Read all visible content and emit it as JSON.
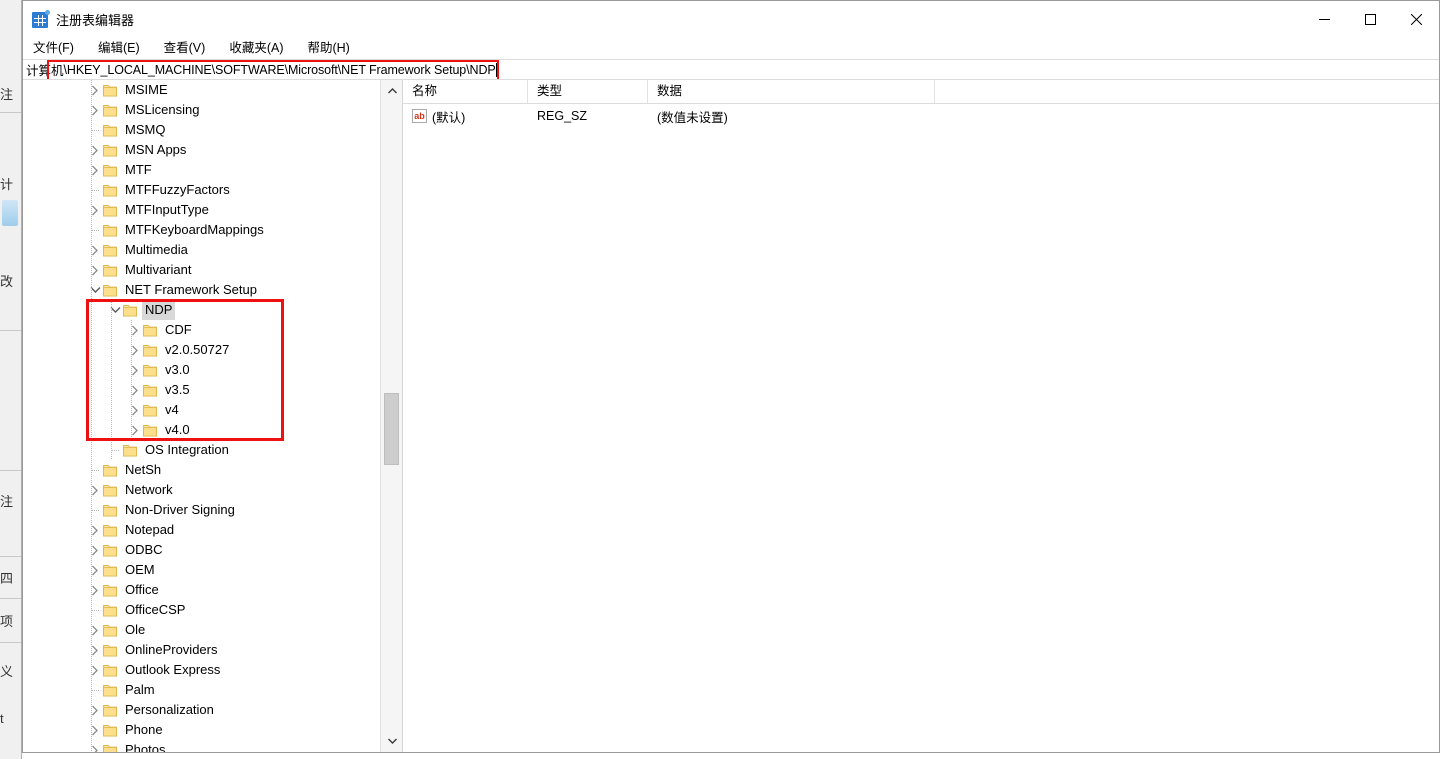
{
  "window": {
    "title": "注册表编辑器",
    "app_icon": "registry-editor-icon",
    "controls": {
      "minimize": "minimize-icon",
      "maximize": "maximize-icon",
      "close": "close-icon"
    }
  },
  "menu": {
    "items": [
      {
        "label": "文件(F)",
        "text": "文件",
        "accel": "F"
      },
      {
        "label": "编辑(E)",
        "text": "编辑",
        "accel": "E"
      },
      {
        "label": "查看(V)",
        "text": "查看",
        "accel": "V"
      },
      {
        "label": "收藏夹(A)",
        "text": "收藏夹",
        "accel": "A"
      },
      {
        "label": "帮助(H)",
        "text": "帮助",
        "accel": "H"
      }
    ]
  },
  "address": {
    "prefix": "计算机",
    "path": "\\HKEY_LOCAL_MACHINE\\SOFTWARE\\Microsoft\\NET Framework Setup\\NDP",
    "full": "计算机\\HKEY_LOCAL_MACHINE\\SOFTWARE\\Microsoft\\NET Framework Setup\\NDP"
  },
  "annotations": {
    "color": "#ee1111",
    "address_box": "address-path-highlight",
    "tree_box": "ndp-subtree-highlight"
  },
  "tree": {
    "items": [
      {
        "label": "MSIME",
        "depth": 1,
        "twisty": "collapsed",
        "selected": false
      },
      {
        "label": "MSLicensing",
        "depth": 1,
        "twisty": "collapsed",
        "selected": false
      },
      {
        "label": "MSMQ",
        "depth": 1,
        "twisty": "none",
        "selected": false
      },
      {
        "label": "MSN Apps",
        "depth": 1,
        "twisty": "collapsed",
        "selected": false
      },
      {
        "label": "MTF",
        "depth": 1,
        "twisty": "collapsed",
        "selected": false
      },
      {
        "label": "MTFFuzzyFactors",
        "depth": 1,
        "twisty": "none",
        "selected": false
      },
      {
        "label": "MTFInputType",
        "depth": 1,
        "twisty": "collapsed",
        "selected": false
      },
      {
        "label": "MTFKeyboardMappings",
        "depth": 1,
        "twisty": "none",
        "selected": false
      },
      {
        "label": "Multimedia",
        "depth": 1,
        "twisty": "collapsed",
        "selected": false
      },
      {
        "label": "Multivariant",
        "depth": 1,
        "twisty": "collapsed",
        "selected": false
      },
      {
        "label": "NET Framework Setup",
        "depth": 1,
        "twisty": "expanded",
        "selected": false
      },
      {
        "label": "NDP",
        "depth": 2,
        "twisty": "expanded",
        "selected": true
      },
      {
        "label": "CDF",
        "depth": 3,
        "twisty": "collapsed",
        "selected": false
      },
      {
        "label": "v2.0.50727",
        "depth": 3,
        "twisty": "collapsed",
        "selected": false
      },
      {
        "label": "v3.0",
        "depth": 3,
        "twisty": "collapsed",
        "selected": false
      },
      {
        "label": "v3.5",
        "depth": 3,
        "twisty": "collapsed",
        "selected": false
      },
      {
        "label": "v4",
        "depth": 3,
        "twisty": "collapsed",
        "selected": false
      },
      {
        "label": "v4.0",
        "depth": 3,
        "twisty": "collapsed",
        "selected": false
      },
      {
        "label": "OS Integration",
        "depth": 2,
        "twisty": "none",
        "selected": false
      },
      {
        "label": "NetSh",
        "depth": 1,
        "twisty": "none",
        "selected": false
      },
      {
        "label": "Network",
        "depth": 1,
        "twisty": "collapsed",
        "selected": false
      },
      {
        "label": "Non-Driver Signing",
        "depth": 1,
        "twisty": "none",
        "selected": false
      },
      {
        "label": "Notepad",
        "depth": 1,
        "twisty": "collapsed",
        "selected": false
      },
      {
        "label": "ODBC",
        "depth": 1,
        "twisty": "collapsed",
        "selected": false
      },
      {
        "label": "OEM",
        "depth": 1,
        "twisty": "collapsed",
        "selected": false
      },
      {
        "label": "Office",
        "depth": 1,
        "twisty": "collapsed",
        "selected": false
      },
      {
        "label": "OfficeCSP",
        "depth": 1,
        "twisty": "none",
        "selected": false
      },
      {
        "label": "Ole",
        "depth": 1,
        "twisty": "collapsed",
        "selected": false
      },
      {
        "label": "OnlineProviders",
        "depth": 1,
        "twisty": "collapsed",
        "selected": false
      },
      {
        "label": "Outlook Express",
        "depth": 1,
        "twisty": "collapsed",
        "selected": false
      },
      {
        "label": "Palm",
        "depth": 1,
        "twisty": "none",
        "selected": false
      },
      {
        "label": "Personalization",
        "depth": 1,
        "twisty": "collapsed",
        "selected": false
      },
      {
        "label": "Phone",
        "depth": 1,
        "twisty": "collapsed",
        "selected": false
      },
      {
        "label": "Photos",
        "depth": 1,
        "twisty": "collapsed",
        "selected": false
      }
    ],
    "scrollbar": {
      "up": "scroll-up-icon",
      "down": "scroll-down-icon"
    }
  },
  "value_list": {
    "columns": [
      "名称",
      "类型",
      "数据"
    ],
    "rows": [
      {
        "icon": "string-value-icon",
        "icon_text": "ab",
        "name": "(默认)",
        "type": "REG_SZ",
        "data": "(数值未设置)"
      }
    ]
  },
  "background_window": {
    "fragments": [
      "注",
      "计",
      "改",
      "注",
      "四",
      "项",
      "义",
      "t"
    ]
  }
}
